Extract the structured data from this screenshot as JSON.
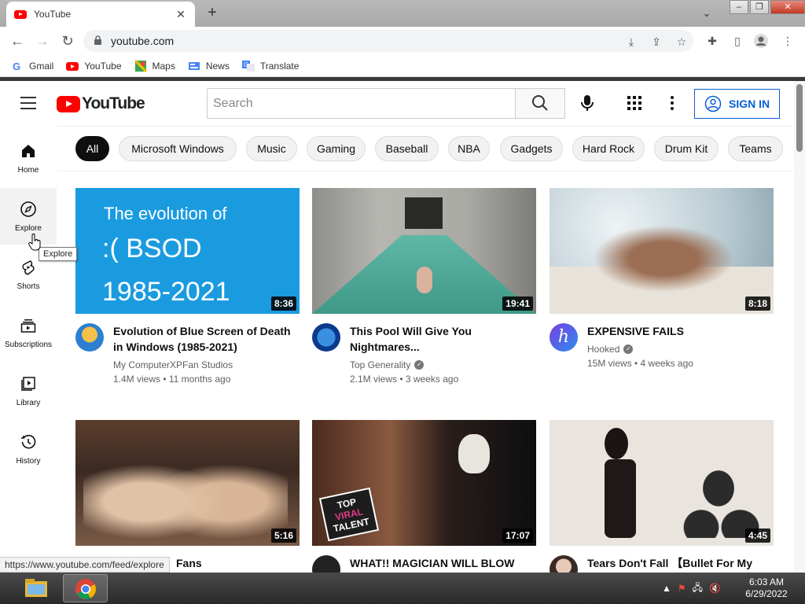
{
  "browser": {
    "tab_title": "YouTube",
    "tab_close": "✕",
    "newtab": "+",
    "url": "youtube.com",
    "bookmarks": [
      {
        "label": "Gmail",
        "icon": "gmail-icon"
      },
      {
        "label": "YouTube",
        "icon": "youtube-icon"
      },
      {
        "label": "Maps",
        "icon": "maps-icon"
      },
      {
        "label": "News",
        "icon": "news-icon"
      },
      {
        "label": "Translate",
        "icon": "translate-icon"
      }
    ],
    "status_url": "https://www.youtube.com/feed/explore"
  },
  "header": {
    "logo_text": "YouTube",
    "search_placeholder": "Search",
    "sign_in": "SIGN IN"
  },
  "chips": [
    "All",
    "Microsoft Windows",
    "Music",
    "Gaming",
    "Baseball",
    "NBA",
    "Gadgets",
    "Hard Rock",
    "Drum Kit",
    "Teams"
  ],
  "sidebar": [
    {
      "label": "Home",
      "icon": "home-icon"
    },
    {
      "label": "Explore",
      "icon": "compass-icon"
    },
    {
      "label": "Shorts",
      "icon": "shorts-icon"
    },
    {
      "label": "Subscriptions",
      "icon": "subscriptions-icon"
    },
    {
      "label": "Library",
      "icon": "library-icon"
    },
    {
      "label": "History",
      "icon": "history-icon"
    }
  ],
  "tooltip": "Explore",
  "videos": [
    {
      "title": "Evolution of Blue Screen of Death in Windows (1985-2021)",
      "channel": "My ComputerXPFan Studios",
      "stats": "1.4M views • 11 months ago",
      "duration": "8:36",
      "thumb_text": {
        "line1": "The evolution of",
        "line2": ":( BSOD",
        "line3": "1985-2021"
      }
    },
    {
      "title": "This Pool Will Give You Nightmares...",
      "channel": "Top Generality",
      "stats": "2.1M views • 3 weeks ago",
      "duration": "19:41"
    },
    {
      "title": "EXPENSIVE FAILS",
      "channel": "Hooked",
      "stats": "15M views • 4 weeks ago",
      "duration": "8:18"
    },
    {
      "title": "Fans",
      "duration": "5:16"
    },
    {
      "title": "WHAT!! MAGICIAN WILL BLOW",
      "duration": "17:07",
      "thumb_badge": [
        "TOP",
        "VIRAL",
        "TALENT"
      ]
    },
    {
      "title": "Tears Don't Fall 【Bullet For My",
      "duration": "4:45"
    }
  ],
  "taskbar": {
    "time": "6:03 AM",
    "date": "6/29/2022"
  },
  "colors": {
    "brand_red": "#ff0000",
    "signin_blue": "#065fd4",
    "bsod_blue": "#1a9be0"
  }
}
